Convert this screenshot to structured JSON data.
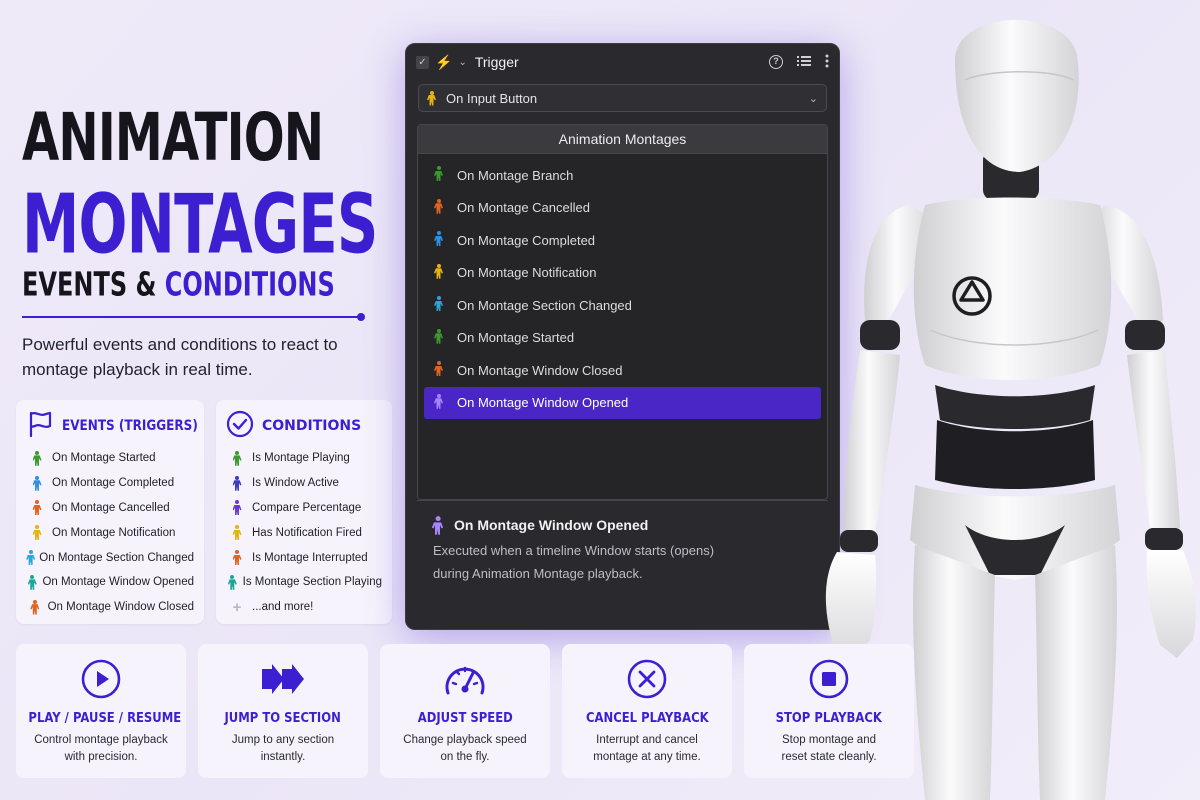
{
  "hero": {
    "title_line1": "ANIMATION",
    "title_line2": "MONTAGES",
    "subtitle_part1": "EVENTS & ",
    "subtitle_part2": "CONDITIONS",
    "tagline": "Powerful events and conditions to react to montage playback in real time."
  },
  "events": {
    "heading": "EVENTS (TRIGGERS)",
    "icon": "flag-icon",
    "items": [
      {
        "label": "On Montage Started",
        "color": "#3a9a2b"
      },
      {
        "label": "On Montage Completed",
        "color": "#2f8fe0"
      },
      {
        "label": "On Montage Cancelled",
        "color": "#e0641f"
      },
      {
        "label": "On Montage Notification",
        "color": "#e6b316"
      },
      {
        "label": "On Montage Section Changed",
        "color": "#2aa6d8"
      },
      {
        "label": "On Montage Window Opened",
        "color": "#18a79a"
      },
      {
        "label": "On Montage Window Closed",
        "color": "#e0641f"
      }
    ]
  },
  "conditions": {
    "heading": "CONDITIONS",
    "icon": "check-circle-icon",
    "items": [
      {
        "label": "Is Montage Playing",
        "color": "#3a9a2b"
      },
      {
        "label": "Is Window Active",
        "color": "#3b3bbf"
      },
      {
        "label": "Compare Percentage",
        "color": "#6a3ad0"
      },
      {
        "label": "Has Notification Fired",
        "color": "#e6b316"
      },
      {
        "label": "Is Montage Interrupted",
        "color": "#e0641f"
      },
      {
        "label": "Is Montage Section Playing",
        "color": "#18a79a"
      }
    ],
    "more": "...and more!"
  },
  "panel": {
    "title": "Trigger",
    "dropdown_value": "On Input Button",
    "dropdown_icon_color": "#e6b316",
    "list_heading": "Animation Montages",
    "items": [
      {
        "label": "On Montage Branch",
        "color": "#3a9a2b"
      },
      {
        "label": "On Montage Cancelled",
        "color": "#e0641f"
      },
      {
        "label": "On Montage Completed",
        "color": "#2f8fe0"
      },
      {
        "label": "On Montage Notification",
        "color": "#e6b316"
      },
      {
        "label": "On Montage Section Changed",
        "color": "#2aa6d8"
      },
      {
        "label": "On Montage Started",
        "color": "#3a9a2b"
      },
      {
        "label": "On Montage Window Closed",
        "color": "#e0641f"
      },
      {
        "label": "On Montage Window Opened",
        "color": "#a884ff",
        "selected": true
      }
    ],
    "detail_title": "On Montage Window Opened",
    "detail_icon_color": "#a884ff",
    "detail_line1": "Executed when a timeline Window starts (opens)",
    "detail_line2": "during Animation Montage playback."
  },
  "actions": [
    {
      "icon": "play-icon",
      "name": "PLAY / PAUSE / RESUME",
      "line1": "Control montage playback",
      "line2": "with precision."
    },
    {
      "icon": "fast-forward-icon",
      "name": "JUMP TO SECTION",
      "line1": "Jump to any section",
      "line2": "instantly."
    },
    {
      "icon": "speedometer-icon",
      "name": "ADJUST SPEED",
      "line1": "Change playback speed",
      "line2": "on the fly."
    },
    {
      "icon": "cancel-circle-icon",
      "name": "CANCEL PLAYBACK",
      "line1": "Interrupt and cancel",
      "line2": "montage at any time."
    },
    {
      "icon": "stop-icon",
      "name": "STOP PLAYBACK",
      "line1": "Stop montage and",
      "line2": "reset state cleanly."
    }
  ],
  "colors": {
    "accent": "#3b1fd1",
    "panel_bg": "#2a2a2e",
    "selection": "#4a26c6"
  }
}
